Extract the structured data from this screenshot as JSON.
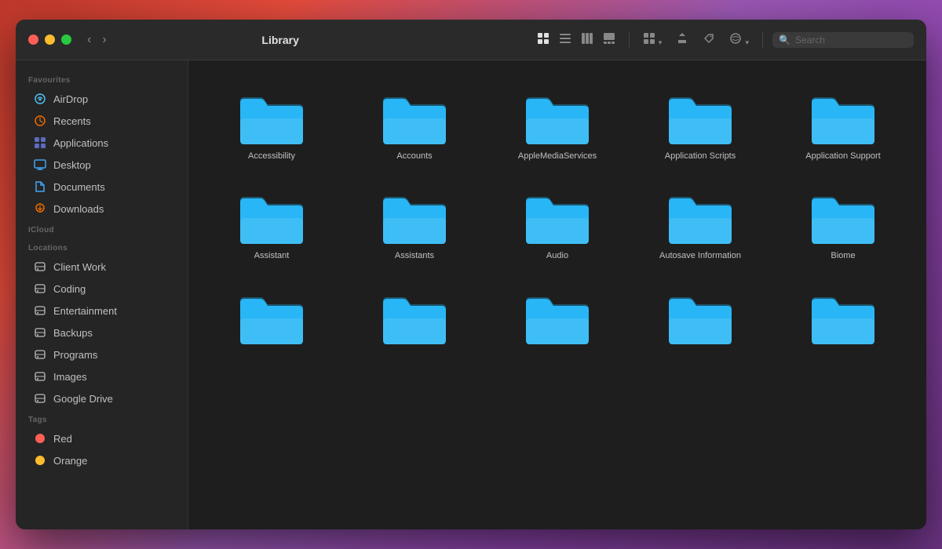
{
  "window": {
    "title": "Library",
    "traffic": {
      "close": "close",
      "minimize": "minimize",
      "maximize": "maximize"
    }
  },
  "toolbar": {
    "title": "Library",
    "search_placeholder": "Search",
    "views": [
      {
        "name": "grid-view",
        "icon": "⊞",
        "active": true
      },
      {
        "name": "list-view",
        "icon": "≡",
        "active": false
      },
      {
        "name": "column-view",
        "icon": "⧉",
        "active": false
      },
      {
        "name": "gallery-view",
        "icon": "▬",
        "active": false
      }
    ],
    "actions": [
      {
        "name": "group-btn",
        "icon": "⊞▾"
      },
      {
        "name": "share-btn",
        "icon": "↑"
      },
      {
        "name": "tag-btn",
        "icon": "⬡"
      },
      {
        "name": "more-btn",
        "icon": "☺▾"
      }
    ]
  },
  "sidebar": {
    "sections": [
      {
        "name": "Favourites",
        "label": "Favourites",
        "items": [
          {
            "id": "airdrop",
            "label": "AirDrop",
            "iconColor": "#4fc3f7",
            "iconType": "airdrop"
          },
          {
            "id": "recents",
            "label": "Recents",
            "iconColor": "#ef6c00",
            "iconType": "recents"
          },
          {
            "id": "applications",
            "label": "Applications",
            "iconColor": "#5c6bc0",
            "iconType": "apps"
          },
          {
            "id": "desktop",
            "label": "Desktop",
            "iconColor": "#42a5f5",
            "iconType": "desktop"
          },
          {
            "id": "documents",
            "label": "Documents",
            "iconColor": "#42a5f5",
            "iconType": "docs"
          },
          {
            "id": "downloads",
            "label": "Downloads",
            "iconColor": "#ef6c00",
            "iconType": "downloads"
          }
        ]
      },
      {
        "name": "iCloud",
        "label": "iCloud",
        "items": []
      },
      {
        "name": "Locations",
        "label": "Locations",
        "items": [
          {
            "id": "client-work",
            "label": "Client Work",
            "iconColor": "#bdbdbd",
            "iconType": "hdd"
          },
          {
            "id": "coding",
            "label": "Coding",
            "iconColor": "#bdbdbd",
            "iconType": "hdd"
          },
          {
            "id": "entertainment",
            "label": "Entertainment",
            "iconColor": "#bdbdbd",
            "iconType": "hdd"
          },
          {
            "id": "backups",
            "label": "Backups",
            "iconColor": "#bdbdbd",
            "iconType": "hdd"
          },
          {
            "id": "programs",
            "label": "Programs",
            "iconColor": "#bdbdbd",
            "iconType": "hdd"
          },
          {
            "id": "images",
            "label": "Images",
            "iconColor": "#bdbdbd",
            "iconType": "hdd"
          },
          {
            "id": "google-drive",
            "label": "Google Drive",
            "iconColor": "#bdbdbd",
            "iconType": "hdd"
          }
        ]
      },
      {
        "name": "Tags",
        "label": "Tags",
        "items": [
          {
            "id": "tag-red",
            "label": "Red",
            "tagColor": "#ff5f57"
          },
          {
            "id": "tag-orange",
            "label": "Orange",
            "tagColor": "#febc2e"
          }
        ]
      }
    ]
  },
  "folders": [
    {
      "id": "accessibility",
      "label": "Accessibility"
    },
    {
      "id": "accounts",
      "label": "Accounts"
    },
    {
      "id": "apple-media",
      "label": "AppleMediaServices"
    },
    {
      "id": "app-scripts",
      "label": "Application Scripts"
    },
    {
      "id": "app-support",
      "label": "Application Support"
    },
    {
      "id": "assistant",
      "label": "Assistant"
    },
    {
      "id": "assistants",
      "label": "Assistants"
    },
    {
      "id": "audio",
      "label": "Audio"
    },
    {
      "id": "autosave",
      "label": "Autosave Information"
    },
    {
      "id": "biome",
      "label": "Biome"
    },
    {
      "id": "folder-11",
      "label": ""
    },
    {
      "id": "folder-12",
      "label": ""
    },
    {
      "id": "folder-13",
      "label": ""
    },
    {
      "id": "folder-14",
      "label": ""
    },
    {
      "id": "folder-15",
      "label": ""
    }
  ],
  "colors": {
    "folder_body": "#29b6f6",
    "folder_tab": "#0288d1",
    "folder_front": "#4dd0e1",
    "folder_shadow": "#0277bd",
    "bg_dark": "#1e1e1e",
    "sidebar_bg": "#252525"
  }
}
